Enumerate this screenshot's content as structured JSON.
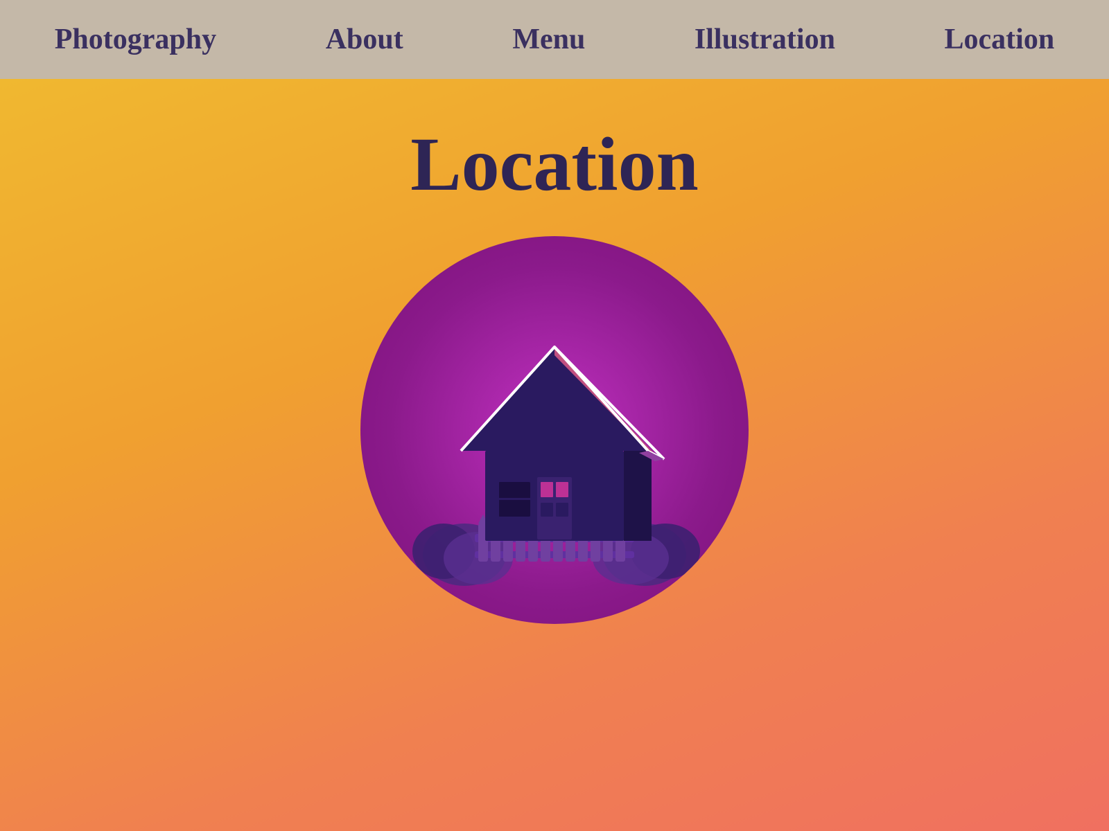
{
  "navbar": {
    "items": [
      {
        "label": "Photography",
        "id": "photography"
      },
      {
        "label": "About",
        "id": "about"
      },
      {
        "label": "Menu",
        "id": "menu"
      },
      {
        "label": "Illustration",
        "id": "illustration"
      },
      {
        "label": "Location",
        "id": "location"
      }
    ]
  },
  "main": {
    "page_title": "Location"
  },
  "colors": {
    "nav_bg": "#c4b8a8",
    "nav_text": "#3a3060",
    "bg_gradient_start": "#f0b830",
    "bg_gradient_end": "#f07060",
    "title_color": "#2e2555",
    "circle_color": "#9e1a9e"
  }
}
